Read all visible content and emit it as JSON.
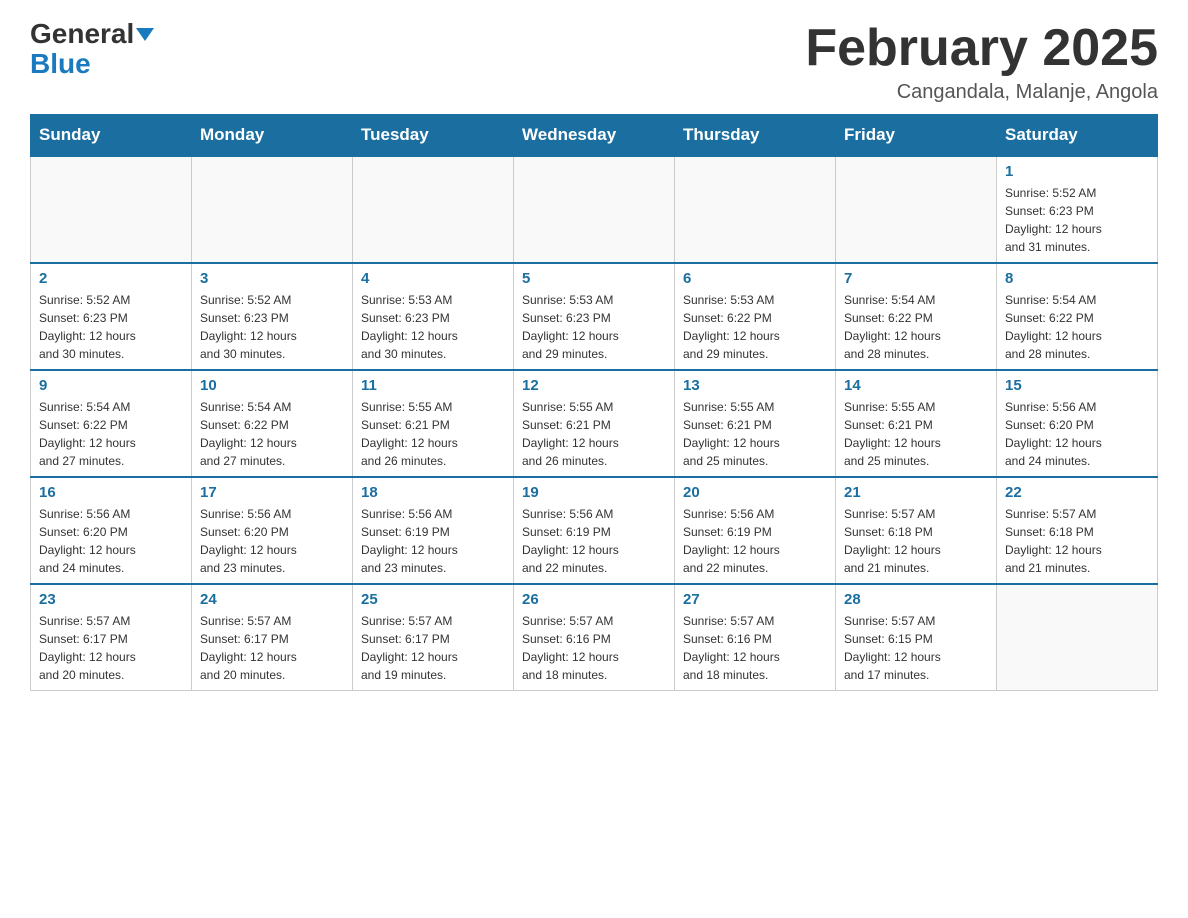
{
  "header": {
    "logo_general": "General",
    "logo_blue": "Blue",
    "title": "February 2025",
    "subtitle": "Cangandala, Malanje, Angola"
  },
  "weekdays": [
    "Sunday",
    "Monday",
    "Tuesday",
    "Wednesday",
    "Thursday",
    "Friday",
    "Saturday"
  ],
  "weeks": [
    [
      {
        "day": "",
        "info": ""
      },
      {
        "day": "",
        "info": ""
      },
      {
        "day": "",
        "info": ""
      },
      {
        "day": "",
        "info": ""
      },
      {
        "day": "",
        "info": ""
      },
      {
        "day": "",
        "info": ""
      },
      {
        "day": "1",
        "info": "Sunrise: 5:52 AM\nSunset: 6:23 PM\nDaylight: 12 hours\nand 31 minutes."
      }
    ],
    [
      {
        "day": "2",
        "info": "Sunrise: 5:52 AM\nSunset: 6:23 PM\nDaylight: 12 hours\nand 30 minutes."
      },
      {
        "day": "3",
        "info": "Sunrise: 5:52 AM\nSunset: 6:23 PM\nDaylight: 12 hours\nand 30 minutes."
      },
      {
        "day": "4",
        "info": "Sunrise: 5:53 AM\nSunset: 6:23 PM\nDaylight: 12 hours\nand 30 minutes."
      },
      {
        "day": "5",
        "info": "Sunrise: 5:53 AM\nSunset: 6:23 PM\nDaylight: 12 hours\nand 29 minutes."
      },
      {
        "day": "6",
        "info": "Sunrise: 5:53 AM\nSunset: 6:22 PM\nDaylight: 12 hours\nand 29 minutes."
      },
      {
        "day": "7",
        "info": "Sunrise: 5:54 AM\nSunset: 6:22 PM\nDaylight: 12 hours\nand 28 minutes."
      },
      {
        "day": "8",
        "info": "Sunrise: 5:54 AM\nSunset: 6:22 PM\nDaylight: 12 hours\nand 28 minutes."
      }
    ],
    [
      {
        "day": "9",
        "info": "Sunrise: 5:54 AM\nSunset: 6:22 PM\nDaylight: 12 hours\nand 27 minutes."
      },
      {
        "day": "10",
        "info": "Sunrise: 5:54 AM\nSunset: 6:22 PM\nDaylight: 12 hours\nand 27 minutes."
      },
      {
        "day": "11",
        "info": "Sunrise: 5:55 AM\nSunset: 6:21 PM\nDaylight: 12 hours\nand 26 minutes."
      },
      {
        "day": "12",
        "info": "Sunrise: 5:55 AM\nSunset: 6:21 PM\nDaylight: 12 hours\nand 26 minutes."
      },
      {
        "day": "13",
        "info": "Sunrise: 5:55 AM\nSunset: 6:21 PM\nDaylight: 12 hours\nand 25 minutes."
      },
      {
        "day": "14",
        "info": "Sunrise: 5:55 AM\nSunset: 6:21 PM\nDaylight: 12 hours\nand 25 minutes."
      },
      {
        "day": "15",
        "info": "Sunrise: 5:56 AM\nSunset: 6:20 PM\nDaylight: 12 hours\nand 24 minutes."
      }
    ],
    [
      {
        "day": "16",
        "info": "Sunrise: 5:56 AM\nSunset: 6:20 PM\nDaylight: 12 hours\nand 24 minutes."
      },
      {
        "day": "17",
        "info": "Sunrise: 5:56 AM\nSunset: 6:20 PM\nDaylight: 12 hours\nand 23 minutes."
      },
      {
        "day": "18",
        "info": "Sunrise: 5:56 AM\nSunset: 6:19 PM\nDaylight: 12 hours\nand 23 minutes."
      },
      {
        "day": "19",
        "info": "Sunrise: 5:56 AM\nSunset: 6:19 PM\nDaylight: 12 hours\nand 22 minutes."
      },
      {
        "day": "20",
        "info": "Sunrise: 5:56 AM\nSunset: 6:19 PM\nDaylight: 12 hours\nand 22 minutes."
      },
      {
        "day": "21",
        "info": "Sunrise: 5:57 AM\nSunset: 6:18 PM\nDaylight: 12 hours\nand 21 minutes."
      },
      {
        "day": "22",
        "info": "Sunrise: 5:57 AM\nSunset: 6:18 PM\nDaylight: 12 hours\nand 21 minutes."
      }
    ],
    [
      {
        "day": "23",
        "info": "Sunrise: 5:57 AM\nSunset: 6:17 PM\nDaylight: 12 hours\nand 20 minutes."
      },
      {
        "day": "24",
        "info": "Sunrise: 5:57 AM\nSunset: 6:17 PM\nDaylight: 12 hours\nand 20 minutes."
      },
      {
        "day": "25",
        "info": "Sunrise: 5:57 AM\nSunset: 6:17 PM\nDaylight: 12 hours\nand 19 minutes."
      },
      {
        "day": "26",
        "info": "Sunrise: 5:57 AM\nSunset: 6:16 PM\nDaylight: 12 hours\nand 18 minutes."
      },
      {
        "day": "27",
        "info": "Sunrise: 5:57 AM\nSunset: 6:16 PM\nDaylight: 12 hours\nand 18 minutes."
      },
      {
        "day": "28",
        "info": "Sunrise: 5:57 AM\nSunset: 6:15 PM\nDaylight: 12 hours\nand 17 minutes."
      },
      {
        "day": "",
        "info": ""
      }
    ]
  ]
}
